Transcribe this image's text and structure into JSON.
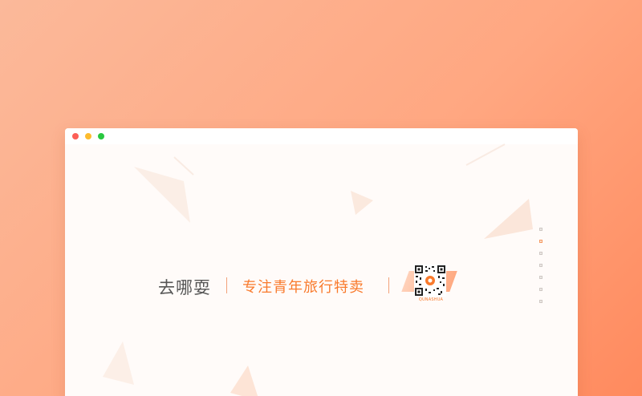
{
  "window": {
    "controls": [
      "close",
      "minimize",
      "maximize"
    ]
  },
  "hero": {
    "brand": "去哪耍",
    "slogan": "专注青年旅行特卖",
    "qr_caption": "QUNASHUA"
  },
  "nav": {
    "dot_count": 7,
    "active_index": 1
  },
  "colors": {
    "accent": "#f97a2c",
    "background_start": "#fbb99a",
    "background_end": "#ff8a5e",
    "window_bg": "#fffbf9"
  }
}
